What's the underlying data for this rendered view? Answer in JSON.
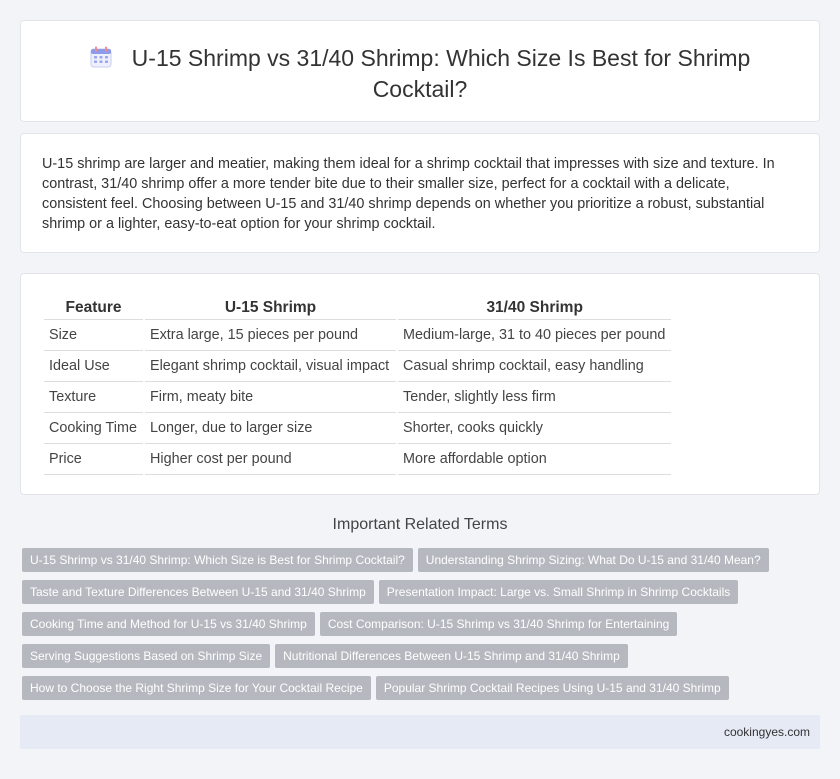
{
  "page": {
    "title": "U-15 Shrimp vs 31/40 Shrimp: Which Size Is Best for Shrimp Cocktail?",
    "title_icon": "calendar-icon",
    "intro": "U-15 shrimp are larger and meatier, making them ideal for a shrimp cocktail that impresses with size and texture. In contrast, 31/40 shrimp offer a more tender bite due to their smaller size, perfect for a cocktail with a delicate, consistent feel. Choosing between U-15 and 31/40 shrimp depends on whether you prioritize a robust, substantial shrimp or a lighter, easy-to-eat option for your shrimp cocktail."
  },
  "table": {
    "headers": [
      "Feature",
      "U-15 Shrimp",
      "31/40 Shrimp"
    ],
    "rows": [
      [
        "Size",
        "Extra large, 15 pieces per pound",
        "Medium-large, 31 to 40 pieces per pound"
      ],
      [
        "Ideal Use",
        "Elegant shrimp cocktail, visual impact",
        "Casual shrimp cocktail, easy handling"
      ],
      [
        "Texture",
        "Firm, meaty bite",
        "Tender, slightly less firm"
      ],
      [
        "Cooking Time",
        "Longer, due to larger size",
        "Shorter, cooks quickly"
      ],
      [
        "Price",
        "Higher cost per pound",
        "More affordable option"
      ]
    ]
  },
  "related": {
    "title": "Important Related Terms",
    "tags": [
      "U-15 Shrimp vs 31/40 Shrimp: Which Size is Best for Shrimp Cocktail?",
      "Understanding Shrimp Sizing: What Do U-15 and 31/40 Mean?",
      "Taste and Texture Differences Between U-15 and 31/40 Shrimp",
      "Presentation Impact: Large vs. Small Shrimp in Shrimp Cocktails",
      "Cooking Time and Method for U-15 vs 31/40 Shrimp",
      "Cost Comparison: U-15 Shrimp vs 31/40 Shrimp for Entertaining",
      "Serving Suggestions Based on Shrimp Size",
      "Nutritional Differences Between U-15 Shrimp and 31/40 Shrimp",
      "How to Choose the Right Shrimp Size for Your Cocktail Recipe",
      "Popular Shrimp Cocktail Recipes Using U-15 and 31/40 Shrimp"
    ]
  },
  "footer": {
    "site": "cookingyes.com"
  }
}
